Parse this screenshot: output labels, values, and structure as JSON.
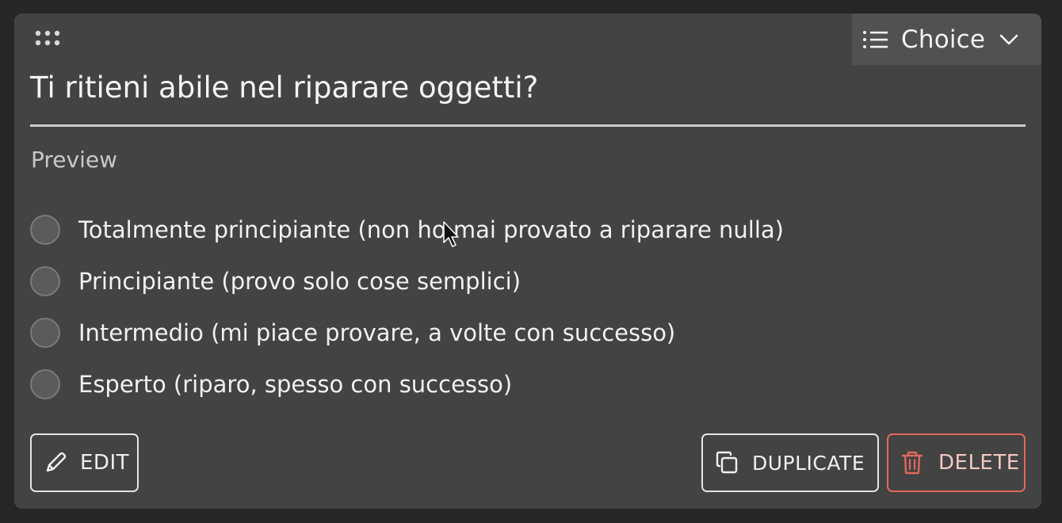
{
  "question_card": {
    "question_text": "Ti ritieni abile nel riparare oggetti?",
    "type_selector": {
      "label": "Choice",
      "icon": "list-icon"
    },
    "preview_label": "Preview",
    "options": [
      {
        "label": "Totalmente principiante (non ho mai provato a riparare nulla)"
      },
      {
        "label": "Principiante (provo solo cose semplici)"
      },
      {
        "label": "Intermedio (mi piace provare, a volte con successo)"
      },
      {
        "label": "Esperto (riparo, spesso con successo)"
      }
    ],
    "actions": {
      "edit_label": "EDIT",
      "duplicate_label": "DUPLICATE",
      "delete_label": "DELETE"
    }
  },
  "colors": {
    "background": "#262626",
    "card": "#434343",
    "type_selector_bg": "#515151",
    "delete_accent": "#e0685a"
  }
}
